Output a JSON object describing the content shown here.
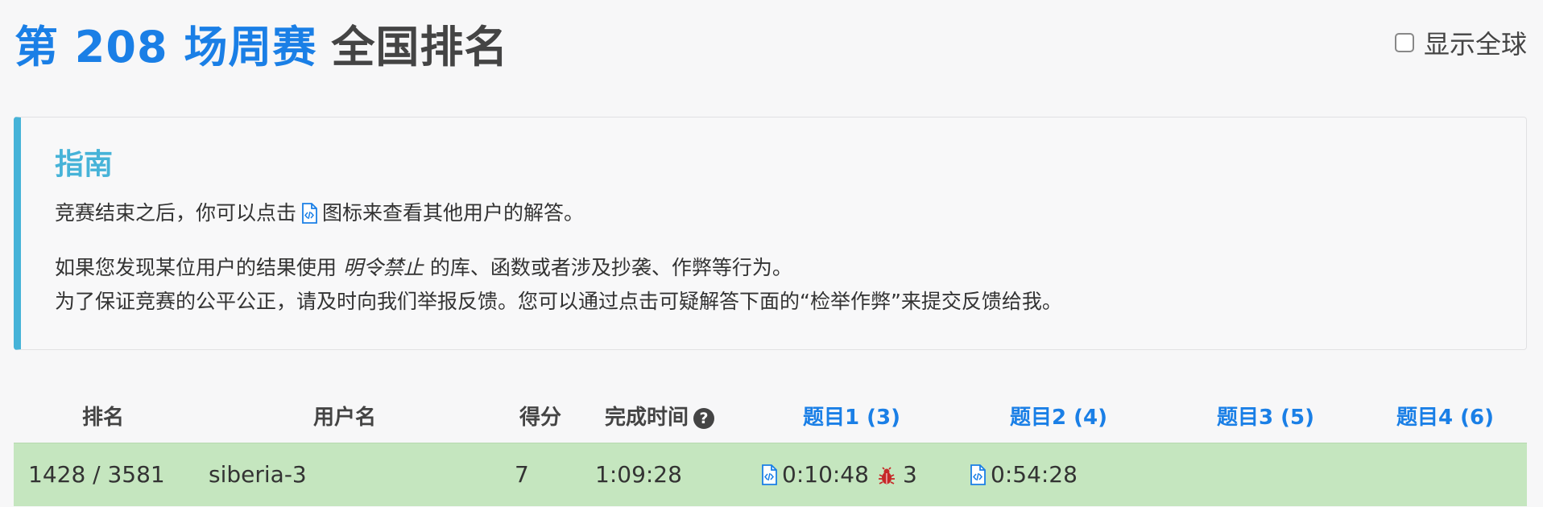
{
  "header": {
    "contest_title": "第 208 场周赛",
    "rank_title": "全国排名",
    "global_toggle_label": "显示全球",
    "global_checked": false
  },
  "guide": {
    "title": "指南",
    "line1_before": "竞赛结束之后，你可以点击",
    "line1_icon": "code-file-icon",
    "line1_after": "图标来查看其他用户的解答。",
    "line2_before": "如果您发现某位用户的结果使用 ",
    "line2_emphasis": "明令禁止",
    "line2_after": " 的库、函数或者涉及抄袭、作弊等行为。",
    "line3": "为了保证竞赛的公平公正，请及时向我们举报反馈。您可以通过点击可疑解答下面的“检举作弊”来提交反馈给我。"
  },
  "table": {
    "headers": {
      "rank": "排名",
      "username": "用户名",
      "score": "得分",
      "finish_time": "完成时间",
      "q1": "题目1 (3)",
      "q2": "题目2 (4)",
      "q3": "题目3 (5)",
      "q4": "题目4 (6)"
    },
    "rows": [
      {
        "rank": "1428 / 3581",
        "username": "siberia-3",
        "score": "7",
        "finish_time": "1:09:28",
        "q1_time": "0:10:48",
        "q1_wrong": "3",
        "q2_time": "0:54:28"
      }
    ]
  },
  "colors": {
    "accent": "#1a7fe6",
    "guide_accent": "#46b3d8",
    "row_highlight": "#c5e6bf",
    "bug": "#c62828"
  }
}
